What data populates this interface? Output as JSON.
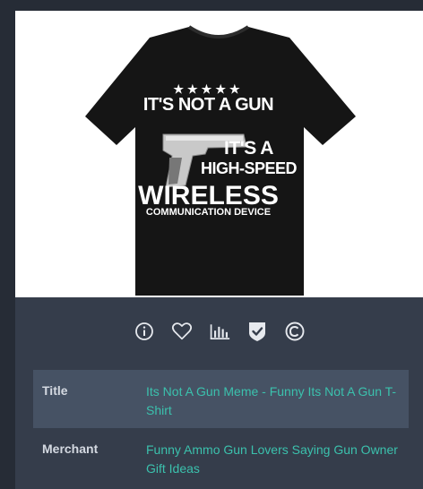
{
  "product": {
    "shirt_text": {
      "stars": "★★★★★",
      "line1": "IT'S NOT A GUN",
      "line2": "IT'S A",
      "line3": "HIGH-SPEED",
      "line4": "WIRELESS",
      "line5": "COMMUNICATION DEVICE"
    }
  },
  "actions": [
    {
      "icon": "info-icon"
    },
    {
      "icon": "heart-icon"
    },
    {
      "icon": "bar-chart-icon"
    },
    {
      "icon": "verified-shield-icon"
    },
    {
      "icon": "copyright-icon"
    }
  ],
  "details": [
    {
      "label": "Title",
      "value": "Its Not A Gun Meme - Funny Its Not A Gun T-Shirt"
    },
    {
      "label": "Merchant",
      "value": "Funny Ammo Gun Lovers Saying Gun Owner Gift Ideas"
    }
  ],
  "colors": {
    "background": "#262c36",
    "card": "#353d4b",
    "row_highlight": "#465264",
    "link": "#3bc1ad",
    "icon": "#e6e9ee"
  }
}
